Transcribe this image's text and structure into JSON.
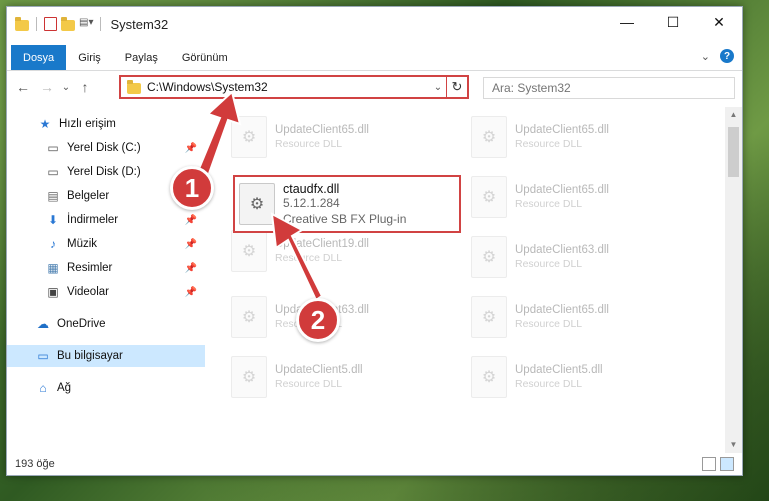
{
  "window": {
    "title": "System32",
    "controls": {
      "minimize": "—",
      "maximize": "☐",
      "close": "✕"
    }
  },
  "ribbon": {
    "tabs": [
      {
        "label": "Dosya",
        "active": true
      },
      {
        "label": "Giriş",
        "active": false
      },
      {
        "label": "Paylaş",
        "active": false
      },
      {
        "label": "Görünüm",
        "active": false
      }
    ],
    "collapse": "⌄",
    "help": "?"
  },
  "nav": {
    "back": "←",
    "forward": "→",
    "recent": "⌄",
    "up": "↑",
    "address": "C:\\Windows\\System32",
    "address_dropdown": "⌄",
    "refresh": "↻",
    "search_placeholder": "Ara: System32"
  },
  "sidebar": {
    "items": [
      {
        "label": "Hızlı erişim",
        "icon": "★",
        "pinned": false
      },
      {
        "label": "Yerel Disk (C:)",
        "icon": "▭",
        "pinned": true
      },
      {
        "label": "Yerel Disk (D:)",
        "icon": "▭",
        "pinned": true
      },
      {
        "label": "Belgeler",
        "icon": "▤",
        "pinned": true
      },
      {
        "label": "İndirmeler",
        "icon": "⬇",
        "pinned": true
      },
      {
        "label": "Müzik",
        "icon": "♪",
        "pinned": true
      },
      {
        "label": "Resimler",
        "icon": "▦",
        "pinned": true
      },
      {
        "label": "Videolar",
        "icon": "▣",
        "pinned": true
      },
      {
        "label": "OneDrive",
        "icon": "☁",
        "pinned": false
      },
      {
        "label": "Bu bilgisayar",
        "icon": "▭",
        "pinned": false,
        "selected": true
      },
      {
        "label": "Ağ",
        "icon": "⌂",
        "pinned": false
      }
    ],
    "pin_glyph": "📌"
  },
  "files": {
    "highlighted": {
      "name": "ctaudfx.dll",
      "version": "5.12.1.284",
      "description": "Creative SB FX Plug-in"
    },
    "faded": [
      {
        "name": "UpdateClient65.dll",
        "description": "Resource DLL"
      },
      {
        "name": "UpdateClient65.dll",
        "description": "Resource DLL"
      },
      {
        "name": "UpdateClient65.dll",
        "description": "Resource DLL"
      },
      {
        "name": "UpdateClient19.dll",
        "description": "Resource DLL"
      },
      {
        "name": "UpdateClient63.dll",
        "description": "Resource DLL"
      },
      {
        "name": "UpdateClient63.dll",
        "description": "Resource DLL"
      },
      {
        "name": "UpdateClient65.dll",
        "description": "Resource DLL"
      },
      {
        "name": "UpdateClient5.dll",
        "description": "Resource DLL"
      },
      {
        "name": "UpdateClient5.dll",
        "description": "Resource DLL"
      }
    ]
  },
  "status": {
    "count": "193 öğe"
  },
  "annotations": {
    "step1": "1",
    "step2": "2",
    "color": "#d13b3b"
  }
}
